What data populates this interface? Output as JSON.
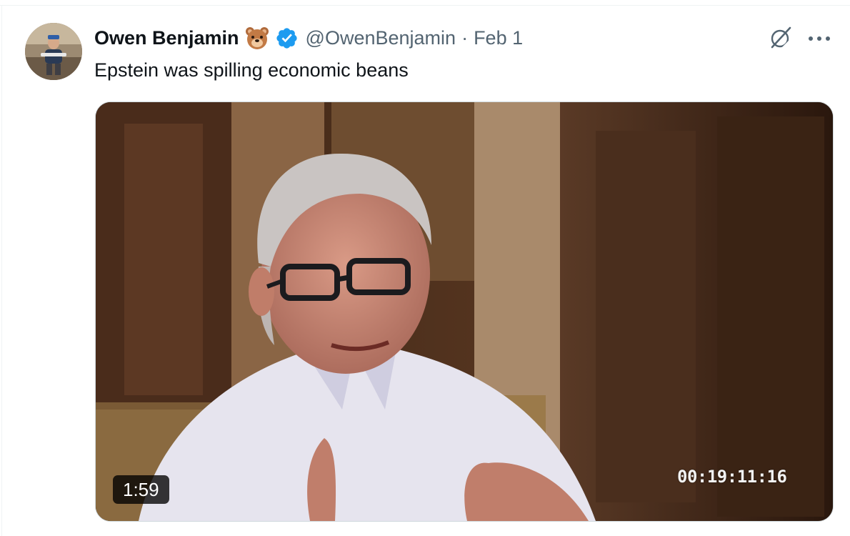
{
  "tweet": {
    "author": {
      "display_name": "Owen Benjamin",
      "name_emoji": "bear-face-emoji",
      "verified": true,
      "handle": "@OwenBenjamin"
    },
    "separator": "·",
    "date": "Feb 1",
    "text": "Epstein was spilling economic beans",
    "media": {
      "type": "video",
      "duration": "1:59",
      "burned_in_timecode": "00:19:11:16"
    }
  },
  "icons": {
    "grok": "grok-slash-icon",
    "more": "more-horizontal-icon",
    "verified": "verified-badge-icon"
  },
  "colors": {
    "text_primary": "#0f1419",
    "text_secondary": "#536471",
    "verified_blue": "#1d9bf0"
  }
}
